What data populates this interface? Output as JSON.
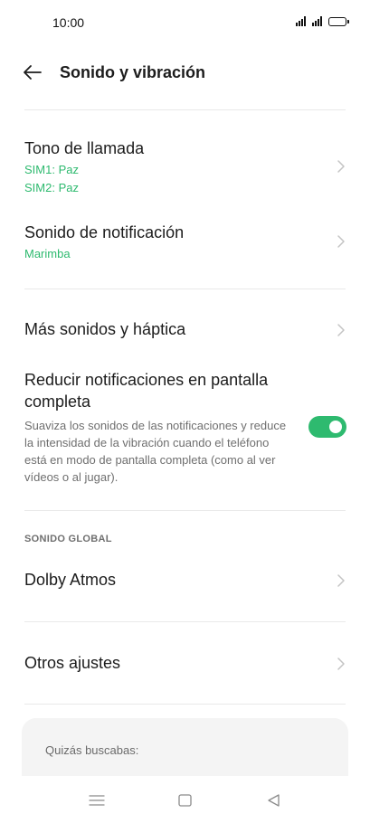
{
  "status_bar": {
    "time": "10:00",
    "icons": [
      "signal-sim1-icon",
      "signal-sim2-icon",
      "battery-icon"
    ]
  },
  "header": {
    "back_icon": "arrow-left-icon",
    "title": "Sonido y vibración"
  },
  "items": {
    "ringtone": {
      "title": "Tono de llamada",
      "sim1": "SIM1: Paz",
      "sim2": "SIM2: Paz"
    },
    "notification_sound": {
      "title": "Sonido de notificación",
      "value": "Marimba"
    },
    "more_sounds": {
      "title": "Más sonidos y háptica"
    },
    "reduce_notifications": {
      "title": "Reducir notificaciones en pantalla completa",
      "description": "Suaviza los sonidos de las notificaciones y reduce la intensidad de la vibración cuando el teléfono está en modo de pantalla completa (como al ver vídeos o al jugar).",
      "enabled": true
    }
  },
  "global_sound": {
    "header": "SONIDO GLOBAL",
    "dolby": {
      "title": "Dolby Atmos"
    },
    "other_settings": {
      "title": "Otros ajustes"
    }
  },
  "suggestions": {
    "title": "Quizás buscabas:"
  },
  "nav_bar": {
    "icons": [
      "menu-icon",
      "home-icon",
      "back-triangle-icon"
    ]
  },
  "colors": {
    "accent": "#2eba6f",
    "text_primary": "#1c1c1c",
    "text_secondary": "#6f6f6f",
    "divider": "#e9e9e9",
    "card_background": "#f4f4f4"
  }
}
